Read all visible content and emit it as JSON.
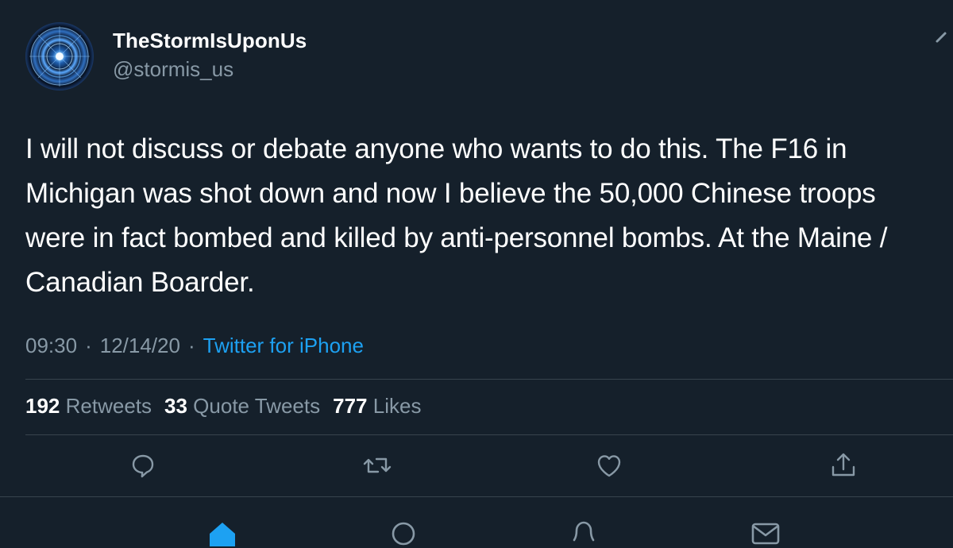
{
  "author": {
    "display_name": "TheStormIsUponUs",
    "handle": "@stormis_us"
  },
  "tweet": {
    "text": "I will not discuss or debate anyone who wants to do this. The F16 in Michigan was shot down and now I believe the 50,000 Chinese troops were in fact bombed and killed by anti-personnel bombs. At the Maine / Canadian Boarder.",
    "time": "09:30",
    "date": "12/14/20",
    "separator": "·",
    "source": "Twitter for iPhone"
  },
  "stats": {
    "retweets_count": "192",
    "retweets_label": "Retweets",
    "quotes_count": "33",
    "quotes_label": "Quote Tweets",
    "likes_count": "777",
    "likes_label": "Likes"
  },
  "icons": {
    "more": "chevron-down-icon",
    "reply": "reply-icon",
    "retweet": "retweet-icon",
    "like": "heart-icon",
    "share": "share-icon",
    "nav_home": "home-icon",
    "nav_search": "search-icon",
    "nav_notifications": "bell-icon",
    "nav_messages": "mail-icon"
  },
  "colors": {
    "background": "#15202b",
    "secondary_text": "#8899a6",
    "accent": "#1da1f2"
  }
}
